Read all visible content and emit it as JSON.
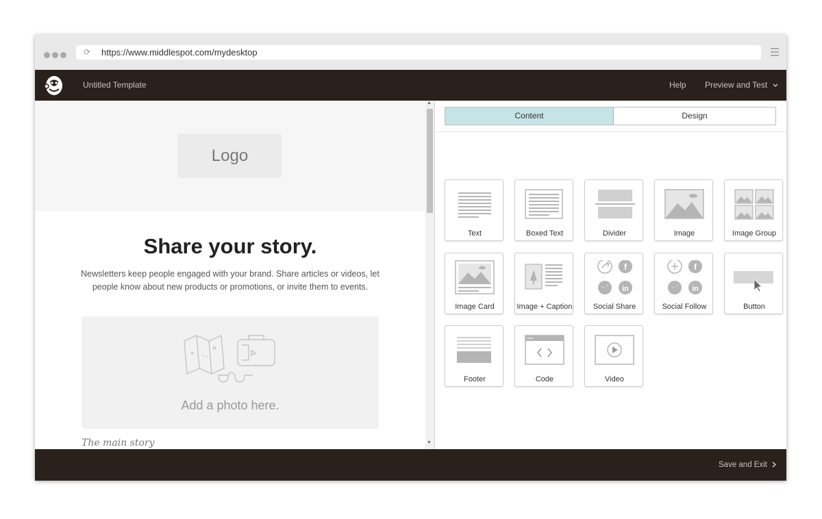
{
  "browser": {
    "url": "https://www.middlespot.com/mydesktop"
  },
  "header": {
    "template_title": "Untitled Template",
    "help_label": "Help",
    "preview_label": "Preview and Test"
  },
  "canvas": {
    "logo_placeholder": "Logo",
    "headline": "Share your story.",
    "subtext": "Newsletters keep people engaged with your brand. Share articles or videos, let people know about new products or promotions, or invite them to events.",
    "photo_placeholder": "Add a photo here.",
    "main_story_label": "The main story"
  },
  "panel": {
    "tabs": [
      {
        "label": "Content",
        "active": true
      },
      {
        "label": "Design",
        "active": false
      }
    ],
    "blocks": [
      {
        "label": "Text",
        "icon": "text-block-icon"
      },
      {
        "label": "Boxed Text",
        "icon": "boxed-text-block-icon"
      },
      {
        "label": "Divider",
        "icon": "divider-block-icon"
      },
      {
        "label": "Image",
        "icon": "image-block-icon"
      },
      {
        "label": "Image Group",
        "icon": "image-group-block-icon"
      },
      {
        "label": "Image Card",
        "icon": "image-card-block-icon"
      },
      {
        "label": "Image + Caption",
        "icon": "image-caption-block-icon"
      },
      {
        "label": "Social Share",
        "icon": "social-share-block-icon"
      },
      {
        "label": "Social Follow",
        "icon": "social-follow-block-icon"
      },
      {
        "label": "Button",
        "icon": "button-block-icon"
      },
      {
        "label": "Footer",
        "icon": "footer-block-icon"
      },
      {
        "label": "Code",
        "icon": "code-block-icon"
      },
      {
        "label": "Video",
        "icon": "video-block-icon"
      }
    ]
  },
  "footer": {
    "save_label": "Save and Exit"
  },
  "colors": {
    "app_bar": "#2a211d",
    "active_tab": "#c6e3e6",
    "icon_gray": "#b5b5b5"
  }
}
